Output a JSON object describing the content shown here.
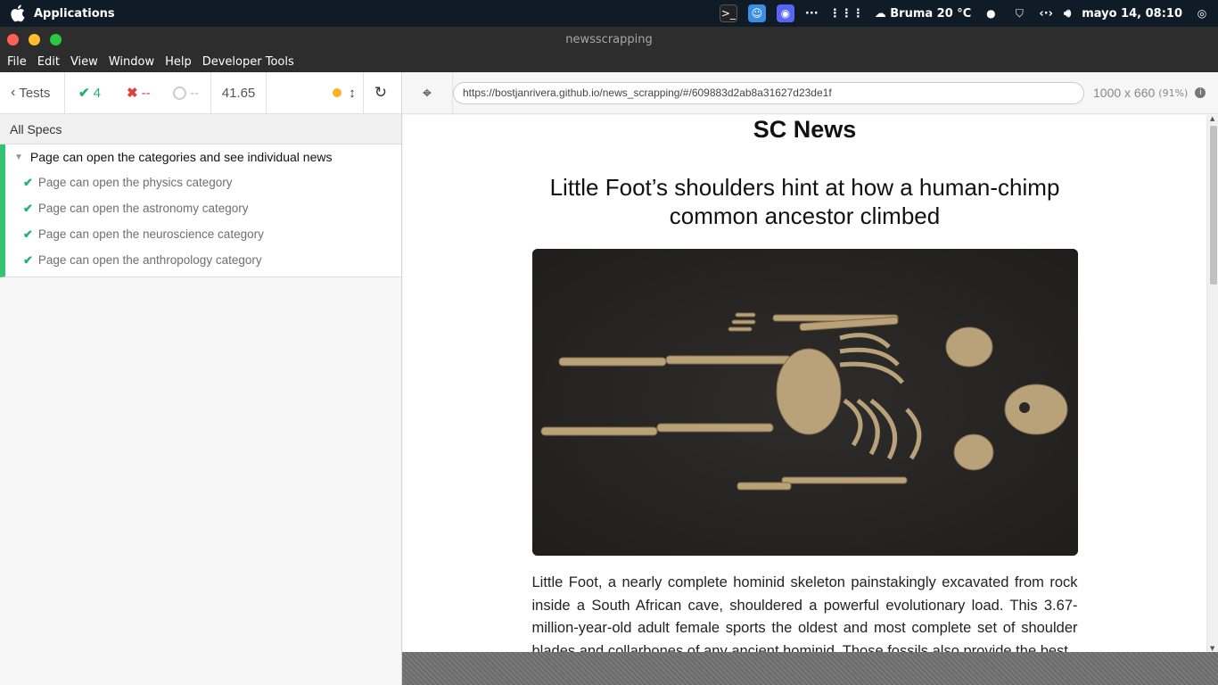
{
  "system_bar": {
    "apps_label": "Applications",
    "weather": "Bruma 20 °C",
    "datetime": "mayo 14, 08:10"
  },
  "window": {
    "title": "newsscrapping"
  },
  "menu": [
    "File",
    "Edit",
    "View",
    "Window",
    "Help",
    "Developer Tools"
  ],
  "reporter": {
    "back_label": "Tests",
    "passed": "4",
    "failed": "--",
    "pending": "--",
    "duration": "41.65",
    "all_specs": "All Specs",
    "suite": "Page can open the categories and see individual news",
    "tests": [
      "Page can open the physics category",
      "Page can open the astronomy category",
      "Page can open the neuroscience category",
      "Page can open the anthropology category"
    ]
  },
  "browser": {
    "url": "https://bostjanrivera.github.io/news_scrapping/#/609883d2ab8a31627d23de1f",
    "viewport": "1000 x 660",
    "zoom": "(91%)"
  },
  "app": {
    "site_title": "SC News",
    "article_title": "Little Foot’s shoulders hint at how a human-chimp common ancestor climbed",
    "article_body": "Little Foot, a nearly complete hominid skeleton painstakingly excavated from rock inside a South African cave, shouldered a powerful evolutionary load. This 3.67-million-year-old adult female sports the oldest and most complete set of shoulder blades and collarbones of any ancient hominid. Those fossils also provide the best"
  },
  "colors": {
    "pass": "#22b36b",
    "fail": "#e0403a",
    "accent_green": "#34c373"
  }
}
